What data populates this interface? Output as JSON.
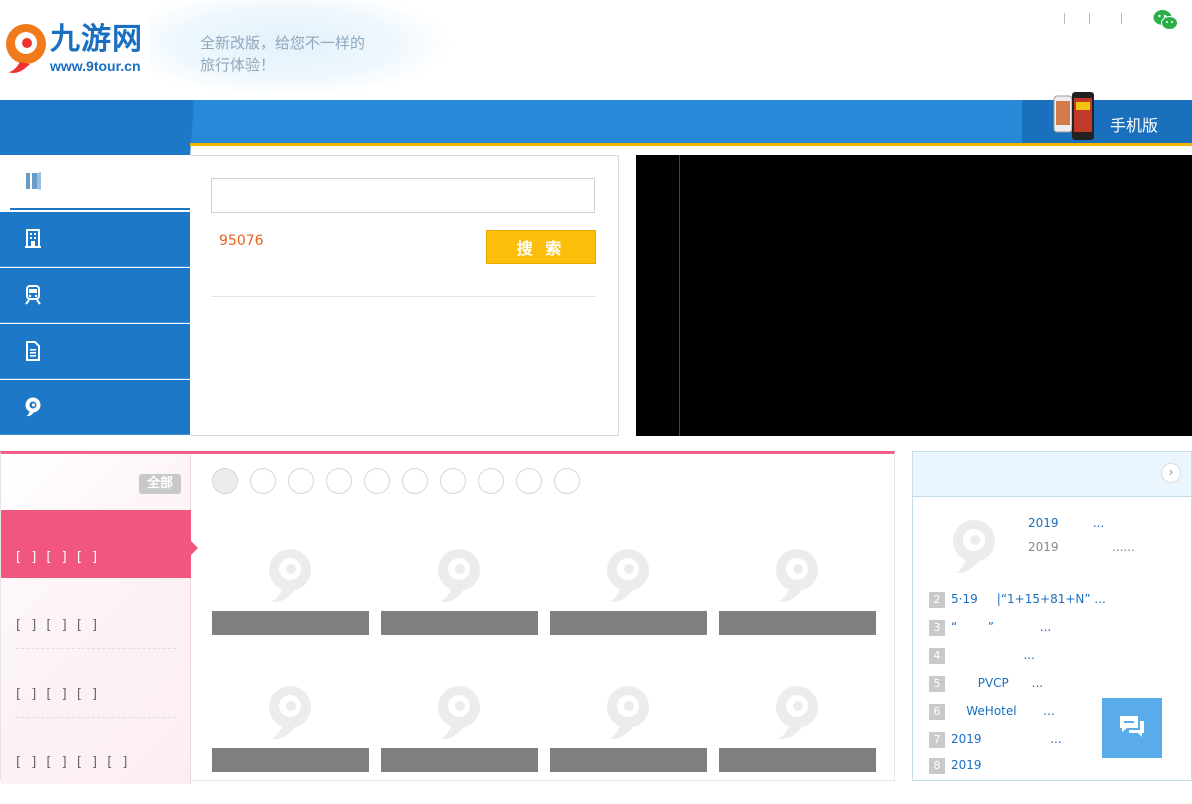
{
  "header": {
    "logo_cn": "九游网",
    "logo_url": "www.9tour.cn",
    "slogan_line1": "全新改版，给您不一样的",
    "slogan_line2": "旅行体验！"
  },
  "mobile": {
    "label": "手机版"
  },
  "search": {
    "input_value": "",
    "hotline": "95076",
    "button_label": "搜 索"
  },
  "categories": {
    "all_label": "全部",
    "items": [
      {
        "label": "[ ] [ ] [ ]"
      },
      {
        "label": "[ ] [ ] [ ]"
      },
      {
        "label": "[ ] [ ] [ ]"
      },
      {
        "label": "[ ] [ ] [ ] [ ]"
      }
    ]
  },
  "news": {
    "top_title": "2019         ...",
    "top_desc": "2019              ......",
    "items": [
      {
        "num": "2",
        "title": "5·19     |“1+15+81+N” ..."
      },
      {
        "num": "3",
        "title": "“        ”            ..."
      },
      {
        "num": "4",
        "title": "                   ..."
      },
      {
        "num": "5",
        "title": "       PVCP      ..."
      },
      {
        "num": "6",
        "title": "    WeHotel       ..."
      },
      {
        "num": "7",
        "title": "2019                  ..."
      },
      {
        "num": "8",
        "title": "2019"
      }
    ]
  },
  "colors": {
    "brand_blue": "#1e78c8",
    "accent_yellow": "#fbbf0b",
    "pink": "#f15680"
  }
}
